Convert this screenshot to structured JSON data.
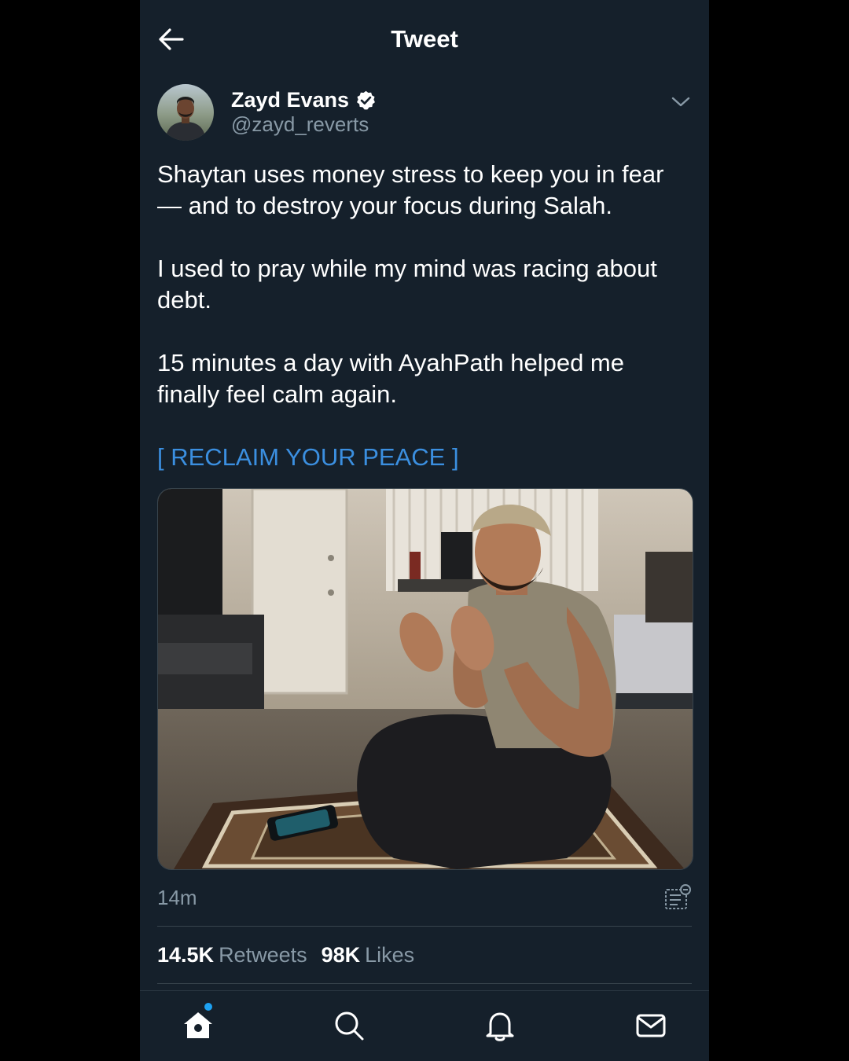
{
  "header": {
    "title": "Tweet"
  },
  "author": {
    "name": "Zayd Evans",
    "handle": "@zayd_reverts",
    "verified": true
  },
  "tweet": {
    "paragraphs": [
      "Shaytan uses money stress to keep you in fear\n— and to destroy your focus during Salah.",
      "I used to pray while my mind was racing about\ndebt.",
      "15 minutes a day with AyahPath helped me\nfinally feel calm again."
    ],
    "cta": "[ RECLAIM YOUR PEACE ]",
    "timestamp": "14m"
  },
  "stats": {
    "retweets_count": "14.5K",
    "retweets_label": "Retweets",
    "likes_count": "98K",
    "likes_label": "Likes"
  },
  "colors": {
    "background": "#15202b",
    "link": "#3b8fe0",
    "muted": "#8899a6",
    "accent": "#1da1f2"
  },
  "icons": {
    "back": "arrow-left-icon",
    "verified": "verified-badge-icon",
    "caret": "chevron-down-icon",
    "analytics": "analytics-icon",
    "nav": [
      "home-icon",
      "search-icon",
      "bell-icon",
      "mail-icon"
    ]
  }
}
